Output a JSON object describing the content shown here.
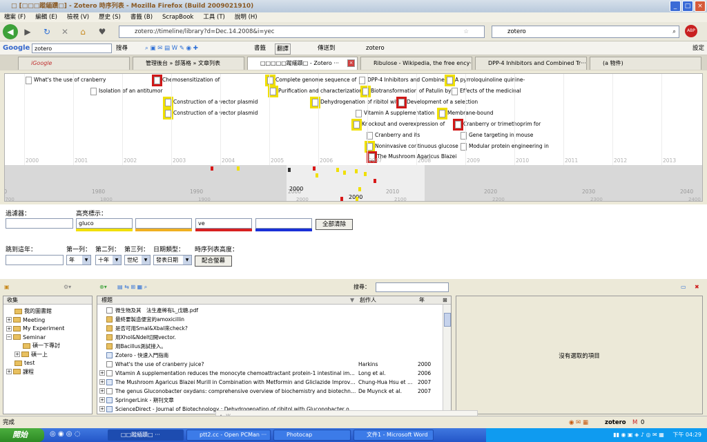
{
  "window": {
    "title": "□ [□□□蹤緬蹟□] - Zotero 時序列表 - Mozilla Firefox (Build 2009021910)"
  },
  "menubar": [
    "檔案 (F)",
    "編輯 (E)",
    "檢視 (V)",
    "歷史 (S)",
    "書籤 (B)",
    "ScrapBook",
    "工具 (T)",
    "說明 (H)"
  ],
  "nav": {
    "url": "zotero://timeline/library?d=Dec.14.2008&i=yec",
    "search": "zotero"
  },
  "googlebar": {
    "logo": "Google",
    "query": "zotero",
    "search_label": "搜尋",
    "bookmarks_label": "書籤",
    "translate_label": "翻譯",
    "send_label": "傳送到",
    "zotero_label": "zotero",
    "settings_label": "設定"
  },
  "tabs": [
    {
      "label": "iGoogle"
    },
    {
      "label": "管理後台 » 部落格 » 文章列表"
    },
    {
      "label": "□□□□□蹤緬蹟□ - Zotero ···"
    },
    {
      "label": "Ribulose - Wikipedia, the free ency···"
    },
    {
      "label": "DPP-4 Inhibitors and Combined Tr···"
    },
    {
      "label": "(a 物件)"
    }
  ],
  "timeline": {
    "events": [
      {
        "text": "What's the use of cranberry",
        "hl": "none"
      },
      {
        "text": "Isolation of an antitumor",
        "hl": "none"
      },
      {
        "text": "Chemosensitization of",
        "hl": "red"
      },
      {
        "text": "Construction of a vector plasmid",
        "hl": "yellow"
      },
      {
        "text": "Construction of a vector plasmid",
        "hl": "yellow"
      },
      {
        "text": "Complete genome sequence of",
        "hl": "yellow"
      },
      {
        "text": "Purification and characterization",
        "hl": "yellow"
      },
      {
        "text": "Dehydrogenation of ribitol with",
        "hl": "yellow"
      },
      {
        "text": "DPP-4 Inhibitors and Combined",
        "hl": "none"
      },
      {
        "text": "Biotransformation of Patulin by",
        "hl": "yellow"
      },
      {
        "text": "Vitamin A supplementation",
        "hl": "none"
      },
      {
        "text": "Knockout and overexpression of",
        "hl": "yellow"
      },
      {
        "text": "Cranberry and its",
        "hl": "none"
      },
      {
        "text": "Noninvasive continuous glucose",
        "hl": "yellow"
      },
      {
        "text": "The Mushroom Agaricus Blazei",
        "hl": "red"
      },
      {
        "text": "Development of a selection",
        "hl": "red"
      },
      {
        "text": "A pyrroloquinoline quinine-",
        "hl": "yellow"
      },
      {
        "text": "Effects of the medicinal",
        "hl": "none"
      },
      {
        "text": "Membrane-bound",
        "hl": "yellow"
      },
      {
        "text": "Cranberry or trimethoprim for",
        "hl": "red"
      },
      {
        "text": "Gene targeting in mouse",
        "hl": "none"
      },
      {
        "text": "Modular protein engineering in",
        "hl": "none"
      }
    ],
    "years_top": [
      "2000",
      "2001",
      "2002",
      "2003",
      "2004",
      "2005",
      "2006",
      "2007",
      "2008",
      "2009",
      "2010",
      "2011",
      "2012",
      "2013"
    ],
    "years_decade": [
      "1970",
      "1980",
      "1990",
      "2000",
      "2010",
      "2020",
      "2030",
      "2040"
    ],
    "years_century": [
      "1700",
      "1800",
      "1900",
      "2000",
      "2100",
      "2200",
      "2300",
      "2400"
    ],
    "decade_label": "2000",
    "century_label": "2000"
  },
  "controls": {
    "filter_label": "過濾器：",
    "highlight_label": "高亮標示：",
    "filter_value": "",
    "highlight1": "gluco",
    "highlight2": "",
    "highlight3": "ve",
    "highlight4": "",
    "clear_all": "全部清除",
    "jump_year_label": "跳到這年：",
    "band1_label": "第一列：",
    "band2_label": "第二列：",
    "band3_label": "第三列：",
    "date_type_label": "日期類型：",
    "height_label": "時序列表高度：",
    "band1_value": "年",
    "band2_value": "十年",
    "band3_value": "世紀",
    "date_type_value": "發表日期",
    "fit_screen": "配合螢幕",
    "highlight_colors": [
      "#f2e000",
      "#f0b020",
      "#d82020",
      "#1a30d8"
    ]
  },
  "zotero": {
    "search_label": "搜尋：",
    "collections_header": "收集",
    "collections": [
      {
        "label": "我的圖書館",
        "exp": "",
        "indent": 0
      },
      {
        "label": "Meeting",
        "exp": "+",
        "indent": 0
      },
      {
        "label": "My Experiment",
        "exp": "+",
        "indent": 0
      },
      {
        "label": "Seminar",
        "exp": "-",
        "indent": 0
      },
      {
        "label": "碩一下專討",
        "exp": "",
        "indent": 1
      },
      {
        "label": "碩一上",
        "exp": "+",
        "indent": 1
      },
      {
        "label": "test",
        "exp": "",
        "indent": 0
      },
      {
        "label": "課程",
        "exp": "+",
        "indent": 0
      }
    ],
    "items_header": {
      "title": "標題",
      "creator": "創作人",
      "year": "年"
    },
    "items": [
      {
        "title": "微生物及其　法生產稀有L_戊糖.pdf",
        "creator": "",
        "year": "",
        "icon": "d",
        "exp": ""
      },
      {
        "title": "最終要製造便宜的amoxicillin",
        "creator": "",
        "year": "",
        "icon": "f",
        "exp": ""
      },
      {
        "title": "是否可用SmaI&XbaI來check?",
        "creator": "",
        "year": "",
        "icon": "f",
        "exp": ""
      },
      {
        "title": "用XhoI&NdeI切開vector.",
        "creator": "",
        "year": "",
        "icon": "f",
        "exp": ""
      },
      {
        "title": "用Bacillus測試接入。",
        "creator": "",
        "year": "",
        "icon": "f",
        "exp": ""
      },
      {
        "title": "Zotero - 快速入門指南",
        "creator": "",
        "year": "",
        "icon": "a",
        "exp": ""
      },
      {
        "title": "What's the use of cranberry juice?",
        "creator": "Harkins",
        "year": "2000",
        "icon": "d",
        "exp": ""
      },
      {
        "title": "Vitamin A supplementation reduces the monocyte chemoattractant protein-1 intestinal immune respons···",
        "creator": "Long et al.",
        "year": "2006",
        "icon": "d",
        "exp": "+"
      },
      {
        "title": "The Mushroom Agaricus Blazei Murill in Combination with Metformin and Gliclazide Improves Insuli···",
        "creator": "Chung-Hua Hsu et al.",
        "year": "2007",
        "icon": "a",
        "exp": "+"
      },
      {
        "title": "The genus Gluconobacter oxydans: comprehensive overview of biochemistry and biotechnological ap···",
        "creator": "De Muynck et al.",
        "year": "2007",
        "icon": "d",
        "exp": "+"
      },
      {
        "title": "SpringerLink - 期刊文章",
        "creator": "",
        "year": "",
        "icon": "a",
        "exp": "+"
      },
      {
        "title": "ScienceDirect - Journal of Biotechnology : Dehydrogenation of ribitol with Gluconobacter oxydans: P···",
        "creator": "",
        "year": "",
        "icon": "a",
        "exp": "+"
      }
    ],
    "no_selection": "沒有選取的項目"
  },
  "status": {
    "left": "完成",
    "zotero": "zotero",
    "email": "0 yimin0428@gmail.com"
  },
  "taskbar": {
    "start": "開始",
    "tasks": [
      "□□蹤緬蹟□ ···",
      "ptt2.cc - Open PCMan ···",
      "Photocap",
      "文件1 - Microsoft Word"
    ],
    "clock": "下午 04:29"
  }
}
